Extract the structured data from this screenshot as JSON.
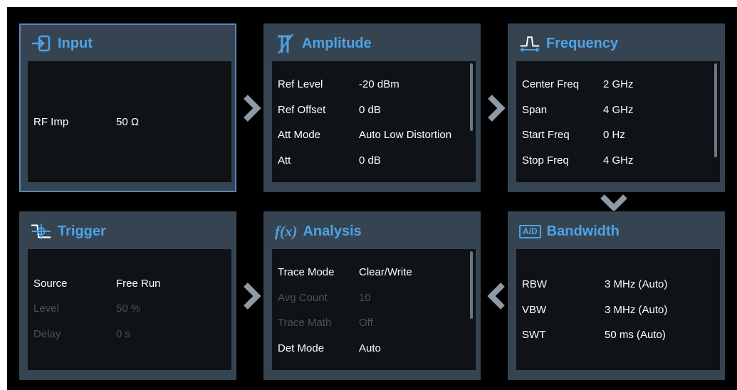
{
  "panels": {
    "input": {
      "title": "Input",
      "icon": "input-icon",
      "rows": [
        {
          "label": "RF Imp",
          "value": "50 Ω"
        }
      ]
    },
    "amplitude": {
      "title": "Amplitude",
      "icon": "amplitude-icon",
      "rows": [
        {
          "label": "Ref Level",
          "value": "-20 dBm"
        },
        {
          "label": "Ref Offset",
          "value": "0 dB"
        },
        {
          "label": "Att Mode",
          "value": "Auto Low Distortion"
        },
        {
          "label": "Att",
          "value": "0 dB"
        }
      ]
    },
    "frequency": {
      "title": "Frequency",
      "icon": "frequency-icon",
      "rows": [
        {
          "label": "Center Freq",
          "value": "2 GHz"
        },
        {
          "label": "Span",
          "value": "4 GHz"
        },
        {
          "label": "Start Freq",
          "value": "0 Hz"
        },
        {
          "label": "Stop Freq",
          "value": "4 GHz"
        }
      ]
    },
    "trigger": {
      "title": "Trigger",
      "icon": "trigger-icon",
      "rows": [
        {
          "label": "Source",
          "value": "Free Run"
        },
        {
          "label": "Level",
          "value": "50 %"
        },
        {
          "label": "Delay",
          "value": "0 s"
        }
      ]
    },
    "analysis": {
      "title": "Analysis",
      "icon": "function-fx-icon",
      "icon_text": "f(x)",
      "rows": [
        {
          "label": "Trace Mode",
          "value": "Clear/Write"
        },
        {
          "label": "Avg Count",
          "value": "10"
        },
        {
          "label": "Trace Math",
          "value": "Off"
        },
        {
          "label": "Det Mode",
          "value": "Auto"
        }
      ]
    },
    "bandwidth": {
      "title": "Bandwidth",
      "icon": "ad-converter-icon",
      "icon_text": "A/D",
      "rows": [
        {
          "label": "RBW",
          "value": "3 MHz (Auto)"
        },
        {
          "label": "VBW",
          "value": "3 MHz (Auto)"
        },
        {
          "label": "SWT",
          "value": "50 ms (Auto)"
        }
      ]
    }
  },
  "colors": {
    "panel_bg": "#364452",
    "body_bg": "#0f1216",
    "title": "#4da3e6",
    "text": "#ffffff",
    "disabled_text": "#4a535c",
    "selected_border": "#5b86b8",
    "arrow": "#8e9aa6"
  }
}
